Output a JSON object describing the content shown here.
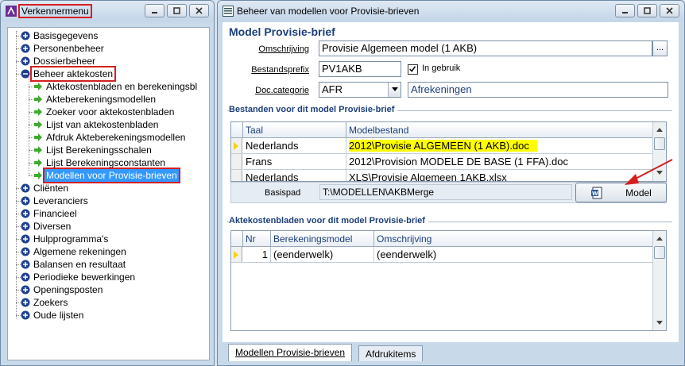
{
  "left_window": {
    "title": "Verkennermenu",
    "tree": [
      {
        "label": "Basisgegevens",
        "icon": "plus-icon",
        "level": 1
      },
      {
        "label": "Personenbeheer",
        "icon": "plus-icon",
        "level": 1
      },
      {
        "label": "Dossierbeheer",
        "icon": "plus-icon",
        "level": 1
      },
      {
        "label": "Beheer aktekosten",
        "icon": "minus-icon",
        "level": 1
      },
      {
        "label": "Aktekostenbladen en berekeningsbl",
        "icon": "arrow-icon",
        "level": 2
      },
      {
        "label": "Akteberekeningsmodellen",
        "icon": "arrow-icon",
        "level": 2
      },
      {
        "label": "Zoeker voor aktekostenbladen",
        "icon": "arrow-icon",
        "level": 2
      },
      {
        "label": "Lijst van aktekostenbladen",
        "icon": "arrow-icon",
        "level": 2
      },
      {
        "label": "Afdruk Akteberekeningsmodellen",
        "icon": "arrow-icon",
        "level": 2
      },
      {
        "label": "Lijst Berekeningsschalen",
        "icon": "arrow-icon",
        "level": 2
      },
      {
        "label": "Lijst Berekeningsconstanten",
        "icon": "arrow-icon",
        "level": 2
      },
      {
        "label": "Modellen voor Provisie-brieven",
        "icon": "arrow-icon",
        "level": 2
      },
      {
        "label": "Cliënten",
        "icon": "plus-icon",
        "level": 1
      },
      {
        "label": "Leveranciers",
        "icon": "plus-icon",
        "level": 1
      },
      {
        "label": "Financieel",
        "icon": "plus-icon",
        "level": 1
      },
      {
        "label": "Diversen",
        "icon": "plus-icon",
        "level": 1
      },
      {
        "label": "Hulpprogramma's",
        "icon": "plus-icon",
        "level": 1
      },
      {
        "label": "Algemene rekeningen",
        "icon": "plus-icon",
        "level": 1
      },
      {
        "label": "Balansen en resultaat",
        "icon": "plus-icon",
        "level": 1
      },
      {
        "label": "Periodieke bewerkingen",
        "icon": "plus-icon",
        "level": 1
      },
      {
        "label": "Openingsposten",
        "icon": "plus-icon",
        "level": 1
      },
      {
        "label": "Zoekers",
        "icon": "plus-icon",
        "level": 1
      },
      {
        "label": "Oude lijsten",
        "icon": "plus-icon",
        "level": 1
      }
    ]
  },
  "right_window": {
    "title": "Beheer van modellen voor Provisie-brieven",
    "form_title": "Model Provisie-brief",
    "labels": {
      "omschrijving": "Omschrijving",
      "bestandsprefix": "Bestandsprefix",
      "doc_categorie": "Doc.categorie",
      "in_gebruik": "In gebruik",
      "basispad": "Basispad"
    },
    "values": {
      "omschrijving": "Provisie Algemeen model (1 AKB)",
      "bestandsprefix": "PV1AKB",
      "doc_categorie": "AFR",
      "doc_categorie_desc": "Afrekeningen",
      "basispad": "T:\\MODELLEN\\AKBMerge",
      "ellipsis": "..."
    },
    "group1": {
      "title": "Bestanden voor dit model Provisie-brief",
      "columns": [
        "Taal",
        "Modelbestand"
      ],
      "rows": [
        {
          "taal": "Nederlands",
          "bestand": "2012\\Provisie ALGEMEEN (1 AKB).doc"
        },
        {
          "taal": "Frans",
          "bestand": "2012\\Provision MODELE DE BASE (1 FFA).doc"
        },
        {
          "taal": "Nederlands",
          "bestand": "XLS\\Provisie Algemeen 1AKB.xlsx"
        }
      ],
      "model_button": "Model"
    },
    "group2": {
      "title": "Aktekostenbladen voor dit model Provisie-brief",
      "columns": [
        "Nr",
        "Berekeningsmodel",
        "Omschrijving"
      ],
      "rows": [
        {
          "nr": "1",
          "model": "(eenderwelk)",
          "omschrijving": "(eenderwelk)"
        }
      ]
    },
    "tabs": [
      "Modellen Provisie-brieven",
      "Afdrukitems"
    ]
  },
  "colors": {
    "highlight_yellow": "#ffff00",
    "selection_blue": "#3399ff",
    "annotation_red": "#d42020",
    "heading_blue": "#1c3f7a"
  }
}
